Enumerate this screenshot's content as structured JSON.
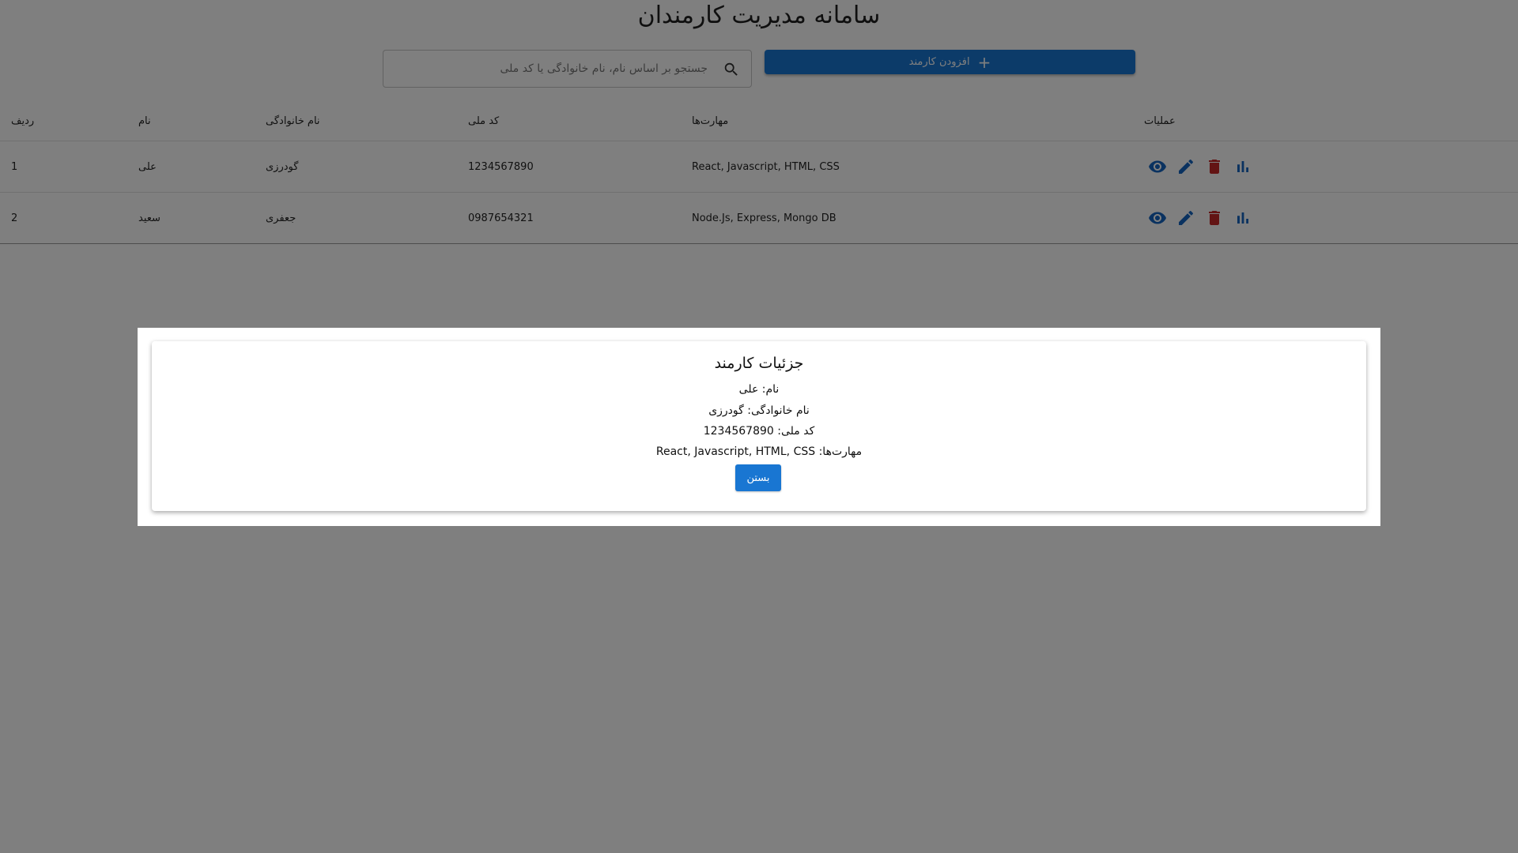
{
  "page": {
    "title": "سامانه مدیریت کارمندان"
  },
  "toolbar": {
    "search_placeholder": "جستجو بر اساس نام، نام خانوادگی یا کد ملی",
    "search_value": "",
    "add_button_label": "افزودن کارمند",
    "add_icon": "plus-icon",
    "search_icon": "search-icon"
  },
  "table": {
    "columns": {
      "rowno": "ردیف",
      "name": "نام",
      "family": "نام خانوادگی",
      "code": "کد ملی",
      "skills": "مهارت‌ها",
      "operations": "عملیات"
    },
    "rows": [
      {
        "rowno": "1",
        "name": "علی",
        "family": "گودرزی",
        "code": "1234567890",
        "skills": "React, Javascript, HTML, CSS"
      },
      {
        "rowno": "2",
        "name": "سعید",
        "family": "جعفری",
        "code": "0987654321",
        "skills": "Node.Js, Express, Mongo DB"
      }
    ],
    "action_icons": [
      "eye-icon",
      "edit-icon",
      "delete-icon",
      "chart-icon"
    ]
  },
  "modal": {
    "title": "جزئیات کارمند",
    "name_line": "نام: علی",
    "family_line": "نام خانوادگی: گودرزی",
    "code_line": "کد ملی: 1234567890",
    "skills_line": "مهارت‌ها: React, Javascript, HTML, CSS",
    "close_label": "بستن"
  },
  "colors": {
    "primary": "#1976d2",
    "delete": "#d32f2f",
    "overlay": "rgba(0,0,0,0.5)"
  }
}
